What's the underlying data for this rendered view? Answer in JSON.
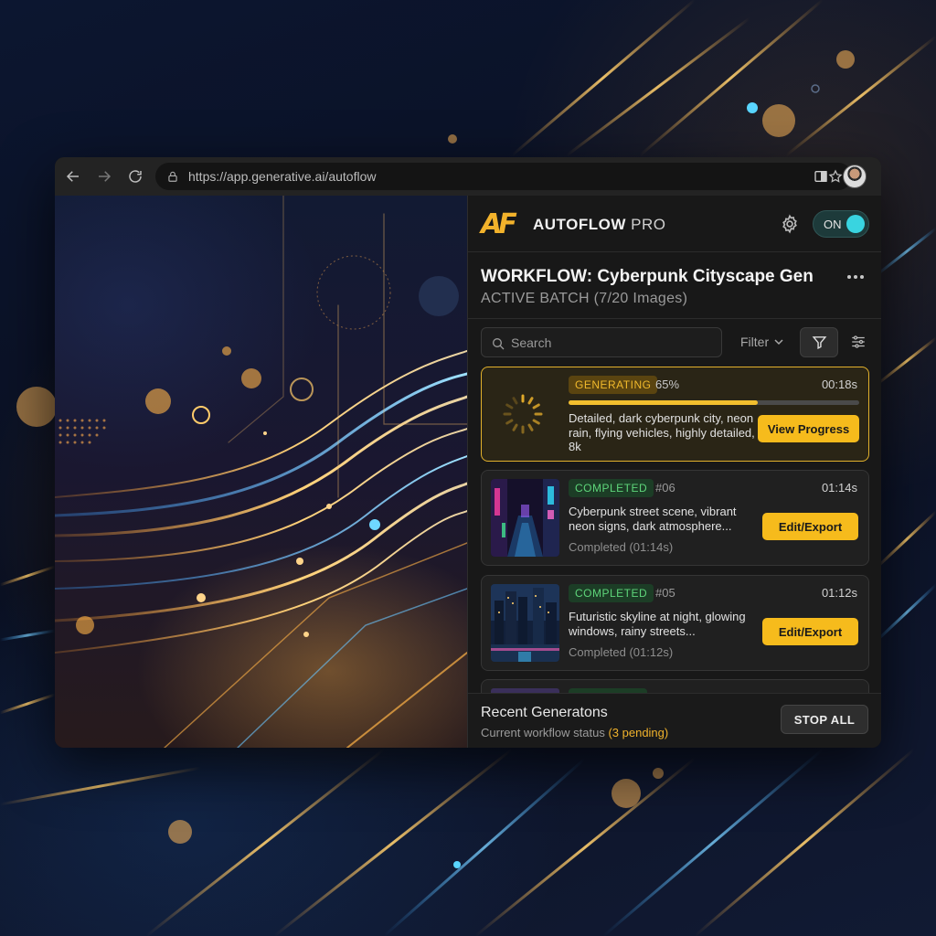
{
  "browser": {
    "url": "https://app.generative.ai/autoflow"
  },
  "extension": {
    "logo_mark": "AF",
    "brand_name": "AUTOFLOW",
    "brand_tier": "PRO",
    "toggle_label": "ON",
    "toggle_state": "on",
    "accent_color": "#f6bb1c",
    "toggle_color": "#39d4e0"
  },
  "workflow": {
    "title": "WORKFLOW: Cyberpunk Cityscape Gen",
    "subtitle": "ACTIVE BATCH (7/20 Images)"
  },
  "search": {
    "placeholder": "Search"
  },
  "filter": {
    "label": "Filter"
  },
  "jobs": [
    {
      "status": "GENERATING",
      "percent": "65%",
      "progress": 0.65,
      "time": "00:18s",
      "prompt": "Detailed, dark cyberpunk city, neon rain, flying vehicles, highly detailed, 8k",
      "action": "View Progress"
    },
    {
      "status": "COMPLETED",
      "number": "#06",
      "time": "01:14s",
      "prompt": "Cyberpunk street scene, vibrant neon signs, dark atmosphere...",
      "detail": "Completed (01:14s)",
      "action": "Edit/Export"
    },
    {
      "status": "COMPLETED",
      "number": "#05",
      "time": "01:12s",
      "prompt": "Futuristic skyline at night, glowing windows, rainy streets...",
      "detail": "Completed (01:12s)",
      "action": "Edit/Export"
    }
  ],
  "footer": {
    "title": "Recent Generatons",
    "status_prefix": "Current workflow status",
    "status_pending": "(3 pending)",
    "stop_label": "STOP ALL"
  }
}
